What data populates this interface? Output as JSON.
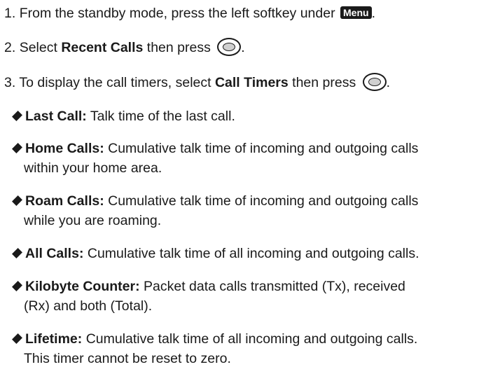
{
  "steps": [
    {
      "num": "1.",
      "text": "From the standby mode, press the left softkey under ",
      "key": "Menu",
      "end": "."
    },
    {
      "num": "2.",
      "pre": "Select ",
      "bold": "Recent Calls",
      "post": " then press ",
      "end": "."
    },
    {
      "num": "3.",
      "pre": "To display the call timers, select ",
      "bold": "Call Timers",
      "post": " then press ",
      "end": "."
    }
  ],
  "bullets": [
    {
      "term": "Last Call:",
      "lines": [
        "Talk time of the last call."
      ]
    },
    {
      "term": "Home Calls:",
      "lines": [
        "Cumulative talk time of incoming and outgoing calls",
        "within your home area."
      ]
    },
    {
      "term": "Roam Calls:",
      "lines": [
        "Cumulative talk time of incoming and outgoing calls",
        "while you are roaming."
      ]
    },
    {
      "term": "All Calls:",
      "lines": [
        "Cumulative talk time of all incoming and outgoing calls."
      ]
    },
    {
      "term": "Kilobyte Counter:",
      "lines": [
        "Packet data calls transmitted (Tx), received",
        "(Rx) and both (Total)."
      ]
    },
    {
      "term": "Lifetime:",
      "lines": [
        "Cumulative talk time of all incoming and outgoing calls.",
        "This timer cannot be reset to zero."
      ]
    }
  ]
}
